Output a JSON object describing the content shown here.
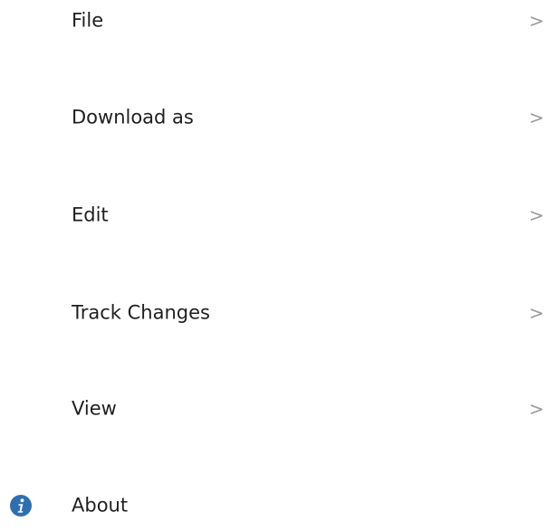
{
  "menu": {
    "items": [
      {
        "label": "File",
        "chevron": ">",
        "icon": null
      },
      {
        "label": "Download as",
        "chevron": ">",
        "icon": null
      },
      {
        "label": "Edit",
        "chevron": ">",
        "icon": null
      },
      {
        "label": "Track Changes",
        "chevron": ">",
        "icon": null
      },
      {
        "label": "View",
        "chevron": ">",
        "icon": null
      },
      {
        "label": "About",
        "chevron": null,
        "icon": "info-icon"
      }
    ]
  },
  "colors": {
    "text": "#1f1f1f",
    "chevron": "#9a9a9a",
    "info_icon": "#2f6fb0",
    "background": "#ffffff"
  }
}
